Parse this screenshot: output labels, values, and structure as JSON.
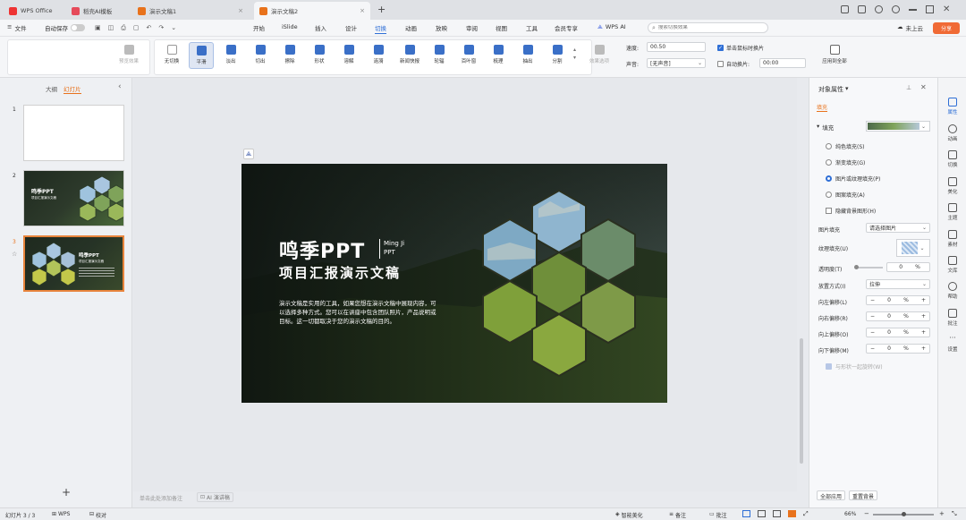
{
  "tabs": {
    "wps": "WPS Office",
    "ai": "稻壳AI模板",
    "doc1": "演示文稿1",
    "doc2": "演示文稿2",
    "close": "×",
    "plus": "+"
  },
  "menu": {
    "file": "文件",
    "autosave": "自动保存",
    "items": [
      "开始",
      "iSlide",
      "插入",
      "设计",
      "切换",
      "动画",
      "放映",
      "审阅",
      "视图",
      "工具",
      "会员专享"
    ],
    "wps_ai": "WPS AI",
    "search_placeholder": "搜索切换效果",
    "cloud": "未上云",
    "share": "分享"
  },
  "ribbon": {
    "preview": "预览效果",
    "effects": [
      "无切换",
      "平滑",
      "淡出",
      "切出",
      "擦除",
      "形状",
      "溶解",
      "涟漪",
      "新闻快报",
      "轮辐",
      "百叶窗",
      "梳理",
      "抽出",
      "分割"
    ],
    "effect_options": "效果选项",
    "speed_label": "速度:",
    "speed_value": "00.50",
    "sound_label": "声音:",
    "sound_value": "[无声音]",
    "click_advance": "单击鼠标时换片",
    "auto_advance": "自动换片:",
    "auto_time": "00:00",
    "apply_all": "应用到全部"
  },
  "left": {
    "outline": "大纲",
    "slides": "幻灯片",
    "numbers": [
      "1",
      "2",
      "3"
    ],
    "add": "+",
    "thumb2_title": "鸣季PPT",
    "thumb2_sub": "项目汇报演示文稿"
  },
  "slide": {
    "title": "鸣季PPT",
    "brand1": "Ming Ji",
    "brand2": "PPT",
    "subtitle": "项目汇报演示文稿",
    "body": "演示文稿是实用的工具，如果您想在演示文稿中展现内容，可以选择多种方式。您可以在讲座中包含团队照片，产品说明或目标。这一切都取决于您的演示文稿的目的。"
  },
  "notes": {
    "hint": "单击此处添加备注",
    "ai": "AI 演讲稿"
  },
  "right": {
    "title": "对象属性",
    "tab": "填充",
    "fill": "填充",
    "options": [
      "纯色填充(S)",
      "渐变填充(G)",
      "图片或纹理填充(P)",
      "图案填充(A)"
    ],
    "hide_bg": "隐藏背景图形(H)",
    "pic_fill": "图片填充",
    "pic_fill_value": "请选择图片",
    "texture": "纹理填充(U)",
    "transparency": "透明度(T)",
    "trans_val": "0",
    "trans_unit": "%",
    "mode": "放置方式(I)",
    "mode_val": "拉伸",
    "offsets": [
      "向左偏移(L)",
      "向右偏移(R)",
      "向上偏移(O)",
      "向下偏移(M)"
    ],
    "offset_val": "0",
    "offset_unit": "%",
    "rotate_with": "与形状一起旋转(W)",
    "apply_all": "全部应用",
    "reset_bg": "重置背景"
  },
  "sidebar": [
    "属性",
    "动画",
    "切换",
    "美化",
    "主题",
    "素材",
    "文库",
    "帮助",
    "批注",
    "设置"
  ],
  "status": {
    "slide": "幻灯片 3 / 3",
    "wps": "WPS",
    "proof": "校对",
    "smart": "智能美化",
    "notes": "备注",
    "comments": "批注",
    "zoom": "66%"
  }
}
